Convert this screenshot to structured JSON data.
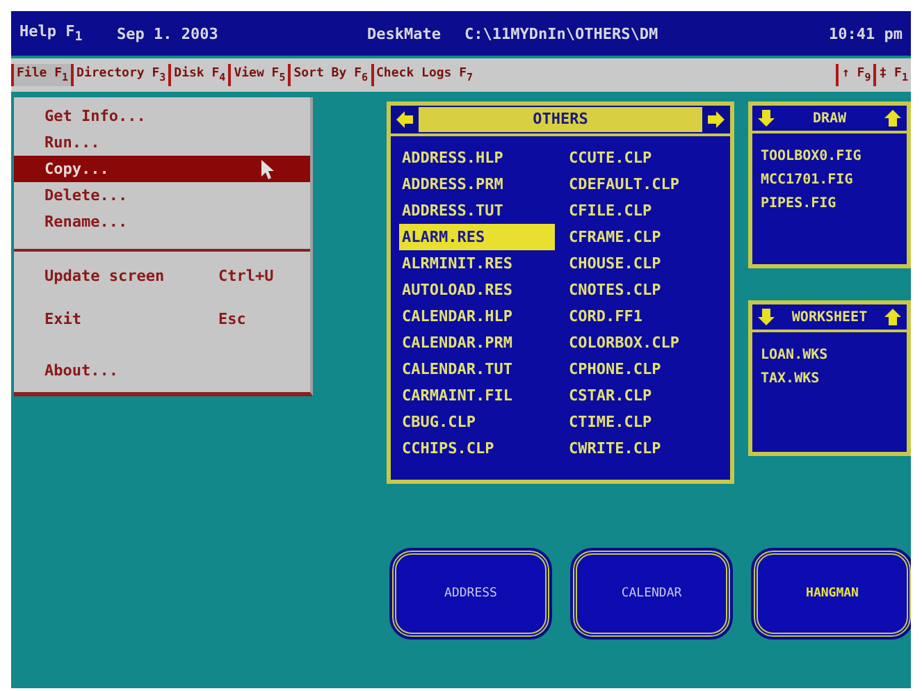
{
  "title_bar": {
    "help": "Help F$_{1}$",
    "date": "Sep 1. 2003",
    "app": "DeskMate",
    "path": "C:\\11MYDnIn\\OTHERS\\DM",
    "time": "10:41 pm"
  },
  "menu_bar": {
    "items": [
      {
        "label": "File F$_{1}$",
        "selected": true
      },
      {
        "label": "Directory F$_{3}$",
        "selected": false
      },
      {
        "label": "Disk F$_{4}$",
        "selected": false
      },
      {
        "label": "View F$_{5}$",
        "selected": false
      },
      {
        "label": "Sort By F$_{6}$",
        "selected": false
      },
      {
        "label": "Check Logs F$_{7}$",
        "selected": false
      }
    ],
    "right_items": [
      {
        "label": "↑ F$_{9}$",
        "selected": false
      },
      {
        "label": "‡ F$_{1}$",
        "selected": false
      }
    ]
  },
  "file_menu": {
    "items": [
      {
        "kind": "item",
        "label": "Get Info...",
        "selected": false
      },
      {
        "kind": "item",
        "label": "Run...",
        "selected": false
      },
      {
        "kind": "item",
        "label": "Copy...",
        "selected": true
      },
      {
        "kind": "item",
        "label": "Delete...",
        "selected": false
      },
      {
        "kind": "item",
        "label": "Rename...",
        "selected": false
      },
      {
        "kind": "separator"
      },
      {
        "kind": "item",
        "label": "Update screen",
        "shortcut": "Ctrl+U",
        "selected": false
      },
      {
        "kind": "item",
        "label": "Exit",
        "shortcut": "Esc",
        "selected": false
      },
      {
        "kind": "item",
        "label": "About...",
        "selected": false
      }
    ]
  },
  "directory_panel": {
    "title": "OTHERS",
    "columns": [
      [
        {
          "name": "ADDRESS.HLP",
          "selected": false
        },
        {
          "name": "ADDRESS.PRM",
          "selected": false
        },
        {
          "name": "ADDRESS.TUT",
          "selected": false
        },
        {
          "name": "ALARM.RES",
          "selected": true
        },
        {
          "name": "ALRMINIT.RES",
          "selected": false
        },
        {
          "name": "AUTOLOAD.RES",
          "selected": false
        },
        {
          "name": "CALENDAR.HLP",
          "selected": false
        },
        {
          "name": "CALENDAR.PRM",
          "selected": false
        },
        {
          "name": "CALENDAR.TUT",
          "selected": false
        },
        {
          "name": "CARMAINT.FIL",
          "selected": false
        },
        {
          "name": "CBUG.CLP",
          "selected": false
        },
        {
          "name": "CCHIPS.CLP",
          "selected": false
        }
      ],
      [
        {
          "name": "CCUTE.CLP",
          "selected": false
        },
        {
          "name": "CDEFAULT.CLP",
          "selected": false
        },
        {
          "name": "CFILE.CLP",
          "selected": false
        },
        {
          "name": "CFRAME.CLP",
          "selected": false
        },
        {
          "name": "CHOUSE.CLP",
          "selected": false
        },
        {
          "name": "CNOTES.CLP",
          "selected": false
        },
        {
          "name": "CORD.FF1",
          "selected": false
        },
        {
          "name": "COLORBOX.CLP",
          "selected": false
        },
        {
          "name": "CPHONE.CLP",
          "selected": false
        },
        {
          "name": "CSTAR.CLP",
          "selected": false
        },
        {
          "name": "CTIME.CLP",
          "selected": false
        },
        {
          "name": "CWRITE.CLP",
          "selected": false
        }
      ]
    ]
  },
  "side_panels": [
    {
      "title": "DRAW",
      "files": [
        "TOOLBOX0.FIG",
        "MCC1701.FIG",
        "PIPES.FIG"
      ]
    },
    {
      "title": "WORKSHEET",
      "files": [
        "LOAN.WKS",
        "TAX.WKS"
      ]
    }
  ],
  "app_buttons": [
    {
      "label": "ADDRESS",
      "selected": false
    },
    {
      "label": "CALENDAR",
      "selected": false
    },
    {
      "label": "HANGMAN",
      "selected": true
    }
  ]
}
